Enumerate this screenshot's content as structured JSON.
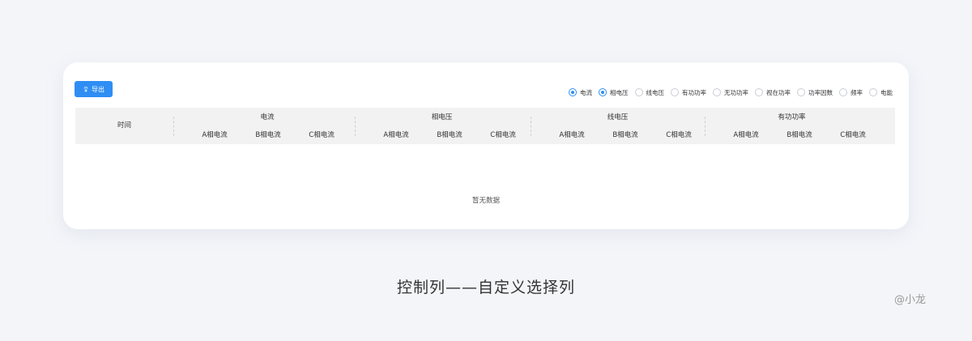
{
  "toolbar": {
    "export_label": "导出",
    "export_icon": "download-icon",
    "accent_color": "#2f8ef4"
  },
  "column_filters": [
    {
      "label": "电流",
      "checked": true
    },
    {
      "label": "相电压",
      "checked": true
    },
    {
      "label": "线电压",
      "checked": false
    },
    {
      "label": "有功功率",
      "checked": false
    },
    {
      "label": "无功功率",
      "checked": false
    },
    {
      "label": "视在功率",
      "checked": false
    },
    {
      "label": "功率因数",
      "checked": false
    },
    {
      "label": "频率",
      "checked": false
    },
    {
      "label": "电能",
      "checked": false
    }
  ],
  "table": {
    "time_header": "时间",
    "groups": [
      {
        "title": "电流",
        "columns": [
          "A相电流",
          "B相电流",
          "C相电流"
        ]
      },
      {
        "title": "相电压",
        "columns": [
          "A相电流",
          "B相电流",
          "C相电流"
        ]
      },
      {
        "title": "线电压",
        "columns": [
          "A相电流",
          "B相电流",
          "C相电流"
        ]
      },
      {
        "title": "有功功率",
        "columns": [
          "A相电流",
          "B相电流",
          "C相电流"
        ]
      }
    ],
    "empty_text": "暂无数据"
  },
  "caption": "控制列——自定义选择列",
  "author": "@小龙"
}
